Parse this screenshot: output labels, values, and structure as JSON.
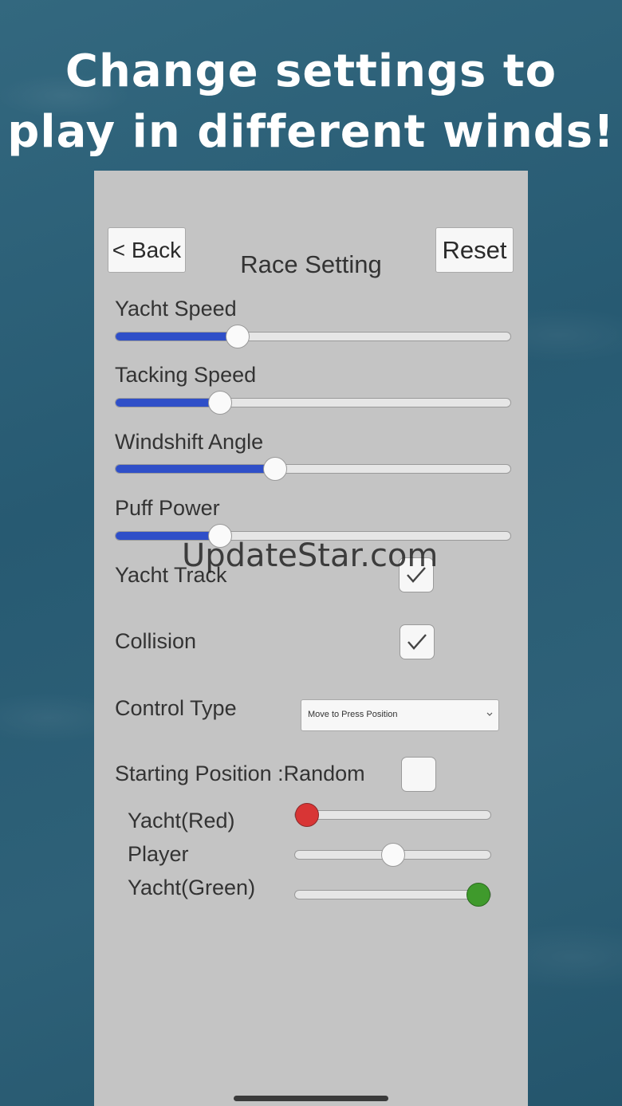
{
  "headline": {
    "line1": "Change settings to",
    "line2": "play in different winds!"
  },
  "panel": {
    "back_label": "< Back",
    "reset_label": "Reset",
    "title": "Race Setting"
  },
  "sliders": {
    "yacht_speed": {
      "label": "Yacht Speed",
      "value": 0.31
    },
    "tacking_speed": {
      "label": "Tacking Speed",
      "value": 0.265
    },
    "windshift_angle": {
      "label": "Windshift Angle",
      "value": 0.405
    },
    "puff_power": {
      "label": "Puff Power",
      "value": 0.265
    }
  },
  "toggles": {
    "yacht_track": {
      "label": "Yacht Track",
      "checked": true
    },
    "collision": {
      "label": "Collision",
      "checked": true
    }
  },
  "control_type": {
    "label": "Control Type",
    "selected": "Move to Press Position"
  },
  "starting_position": {
    "label": "Starting Position :Random",
    "checked": false,
    "yachts": [
      {
        "label": "Yacht(Red)",
        "value": 0.06,
        "color": "#d83535"
      },
      {
        "label": "Player",
        "value": 0.5,
        "color": "#fafafa"
      },
      {
        "label": "Yacht(Green)",
        "value": 0.94,
        "color": "#3f9a2c"
      }
    ]
  },
  "watermark": "UpdateStar.com",
  "colors": {
    "slider_fill": "#2f4fc8",
    "panel_bg": "#c4c4c4",
    "ocean_bg": "#2b5d75"
  }
}
